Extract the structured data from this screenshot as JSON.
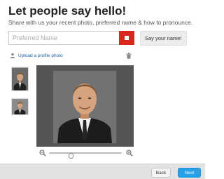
{
  "header": {
    "title": "Let people say hello!",
    "subtitle": "Share with us your recent photo, preferred name & how to pronounce."
  },
  "name_form": {
    "placeholder": "Preferred Name",
    "record_icon": "stop-icon",
    "say_name_label": "Say your name!",
    "accent": "#d9281e"
  },
  "photo": {
    "upload_label": "Upload a profile photo",
    "upload_icon": "upload-icon",
    "delete_icon": "trash-icon",
    "thumbnails": [
      "profile-photo-large",
      "profile-photo-small"
    ],
    "zoom_out_icon": "zoom-out-icon",
    "zoom_in_icon": "zoom-in-icon",
    "zoom_level": 0.3
  },
  "footer": {
    "back_label": "Back",
    "next_label": "Next",
    "next_color": "#27a0e8"
  }
}
